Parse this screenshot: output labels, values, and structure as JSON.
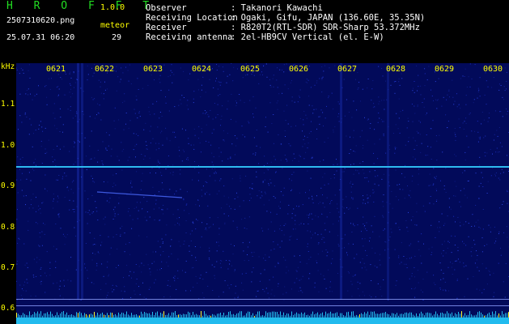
{
  "app": {
    "name": "H R O F F T",
    "version": "1.0.0"
  },
  "file": {
    "name": "2507310620.png",
    "datetime": "25.07.31 06:20"
  },
  "meteor": {
    "label": "meteor",
    "count": "29"
  },
  "info": [
    {
      "key": "Observer",
      "value": ": Takanori Kawachi"
    },
    {
      "key": "Receiving Location",
      "value": ": Ogaki, Gifu, JAPAN (136.60E, 35.35N)"
    },
    {
      "key": "Receiver",
      "value": ": R820T2(RTL-SDR) SDR-Sharp 53.372MHz"
    },
    {
      "key": "Receiving antenna",
      "value": ": 2el-HB9CV Vertical (el. E-W)"
    }
  ],
  "axis": {
    "y_unit": "kHz",
    "y_ticks": [
      "1.1",
      "1.0",
      "0.9",
      "0.8",
      "0.7",
      "0.6"
    ],
    "x_ticks": [
      "0621",
      "0622",
      "0623",
      "0624",
      "0625",
      "0626",
      "0627",
      "0628",
      "0629",
      "0630"
    ]
  },
  "colors": {
    "bg": "#000000",
    "title": "#22dd22",
    "accent": "#ffff00",
    "spectrum": "#020a5a",
    "signal": "#33ccff"
  }
}
